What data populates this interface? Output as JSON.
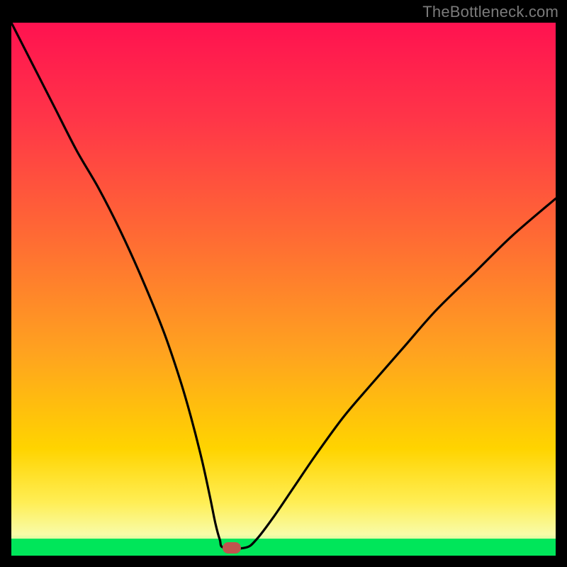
{
  "watermark": "TheBottleneck.com",
  "colors": {
    "gradient": [
      "#ff1250",
      "#ff3548",
      "#ff6a34",
      "#ffa31f",
      "#ffd400",
      "#ffee55",
      "#f8fca8",
      "#7cf08a"
    ],
    "green_band": "#00e65a",
    "marker": "#c0544e"
  },
  "chart_data": {
    "type": "line",
    "title": "",
    "xlabel": "",
    "ylabel": "",
    "xlim": [
      0,
      100
    ],
    "ylim": [
      0,
      100
    ],
    "x": [
      0,
      2,
      5,
      8,
      12,
      16,
      20,
      24,
      28,
      31,
      33,
      35,
      36.5,
      37.5,
      38.3,
      39,
      43,
      45,
      48,
      52,
      56,
      61,
      66,
      72,
      78,
      85,
      92,
      100
    ],
    "y": [
      100,
      96,
      90,
      84,
      76,
      69,
      61,
      52,
      42,
      33,
      26,
      18,
      11,
      6,
      3,
      1.5,
      1.5,
      3,
      7,
      13,
      19,
      26,
      32,
      39,
      46,
      53,
      60,
      67
    ],
    "marker": {
      "x": 40.5,
      "y": 1.5
    },
    "notes": "V-shaped bottleneck curve on rainbow heat background; minimum (optimal) around x≈40."
  }
}
